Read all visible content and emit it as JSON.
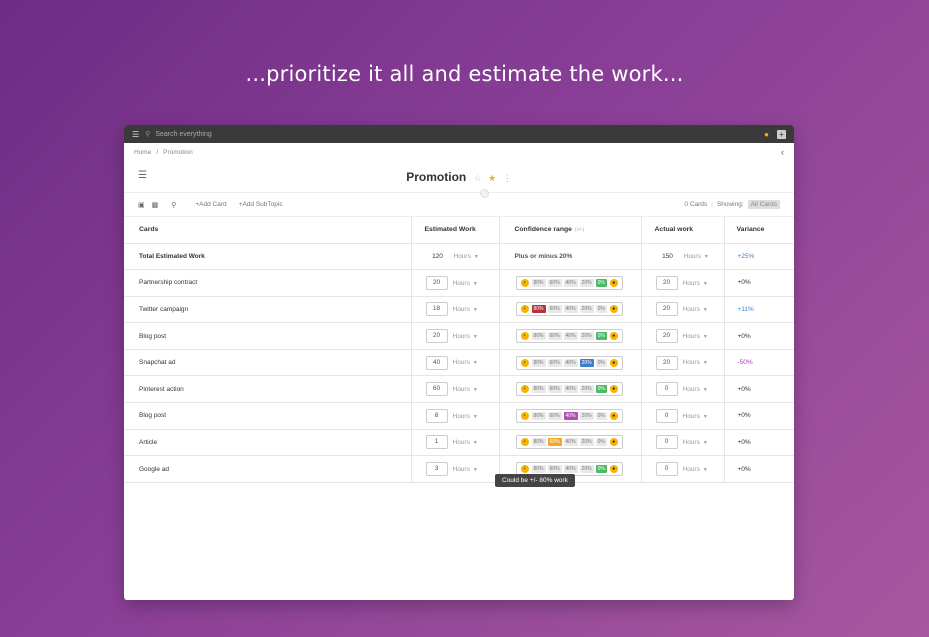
{
  "headline": "...prioritize it all and estimate the work...",
  "topbar": {
    "search_placeholder": "Search everything"
  },
  "breadcrumb": {
    "home": "Home",
    "sep": "/",
    "current": "Promotion"
  },
  "page": {
    "title": "Promotion"
  },
  "toolbar": {
    "add_card": "+Add Card",
    "add_subtopic": "+Add SubTopic",
    "cards_count": "0 Cards",
    "showing_label": "Showing:",
    "filter_value": "All Cards"
  },
  "table": {
    "headers": {
      "cards": "Cards",
      "estimated": "Estimated Work",
      "confidence": "Confidence range",
      "confidence_hint": "(+/-)",
      "actual": "Actual work",
      "variance": "Variance"
    },
    "total": {
      "label": "Total Estimated Work",
      "estimated": "120",
      "unit": "Hours",
      "confidence": "Plus or minus 20%",
      "actual": "150",
      "variance": "+25%"
    },
    "confidence_options": [
      "80%",
      "60%",
      "40%",
      "20%",
      "0%"
    ],
    "rows": [
      {
        "name": "Partnership contract",
        "estimated": "20",
        "unit": "Hours",
        "selected": 4,
        "actual": "20",
        "variance": "+0%"
      },
      {
        "name": "Twitter campaign",
        "estimated": "18",
        "unit": "Hours",
        "selected": 0,
        "actual": "20",
        "variance": "+11%"
      },
      {
        "name": "Blog post",
        "estimated": "20",
        "unit": "Hours",
        "selected": 4,
        "actual": "20",
        "variance": "+0%"
      },
      {
        "name": "Snapchat ad",
        "estimated": "40",
        "unit": "Hours",
        "selected": 3,
        "actual": "20",
        "variance": "-50%"
      },
      {
        "name": "Pinterest action",
        "estimated": "60",
        "unit": "Hours",
        "selected": 4,
        "actual": "0",
        "variance": "+0%"
      },
      {
        "name": "Blog post",
        "estimated": "8",
        "unit": "Hours",
        "selected": 2,
        "actual": "0",
        "variance": "+0%"
      },
      {
        "name": "Article",
        "estimated": "1",
        "unit": "Hours",
        "selected": 1,
        "actual": "0",
        "variance": "+0%"
      },
      {
        "name": "Google ad",
        "estimated": "3",
        "unit": "Hours",
        "selected": 4,
        "actual": "0",
        "variance": "+0%"
      }
    ]
  },
  "option_colors": [
    "#b5323f",
    "#f5a623",
    "#b24fb3",
    "#3e7fc8",
    "#4fb96a"
  ],
  "tooltip": "Could be +/- 80% work"
}
